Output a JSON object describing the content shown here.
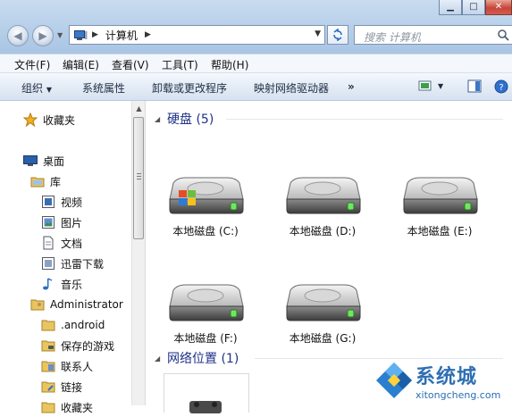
{
  "address": {
    "crumbs": [
      "计算机"
    ]
  },
  "search": {
    "placeholder": "搜索 计算机"
  },
  "menu": {
    "items": [
      "文件(F)",
      "编辑(E)",
      "查看(V)",
      "工具(T)",
      "帮助(H)"
    ]
  },
  "toolbar": {
    "organize": "组织",
    "system_properties": "系统属性",
    "uninstall_change": "卸载或更改程序",
    "map_drive": "映射网络驱动器",
    "more": "»"
  },
  "nav_pane": {
    "favorites": "收藏夹",
    "desktop": "桌面",
    "libraries": "库",
    "videos": "视频",
    "pictures": "图片",
    "documents": "文档",
    "xunlei": "迅雷下载",
    "music": "音乐",
    "administrator": "Administrator",
    "android": ".android",
    "saved_games": "保存的游戏",
    "contacts": "联系人",
    "links": "链接",
    "last_partial": "收藏夹"
  },
  "content": {
    "hard_drives_title": "硬盘 (5)",
    "network_title": "网络位置 (1)",
    "drives": [
      {
        "label": "本地磁盘 (C:)",
        "system": true
      },
      {
        "label": "本地磁盘 (D:)",
        "system": false
      },
      {
        "label": "本地磁盘 (E:)",
        "system": false
      },
      {
        "label": "本地磁盘 (F:)",
        "system": false
      },
      {
        "label": "本地磁盘 (G:)",
        "system": false
      }
    ]
  },
  "watermark": {
    "name": "系统城",
    "url": "xitongcheng.com"
  },
  "colors": {
    "group_title": "#1e3287",
    "accent": "#2f6fb3"
  }
}
